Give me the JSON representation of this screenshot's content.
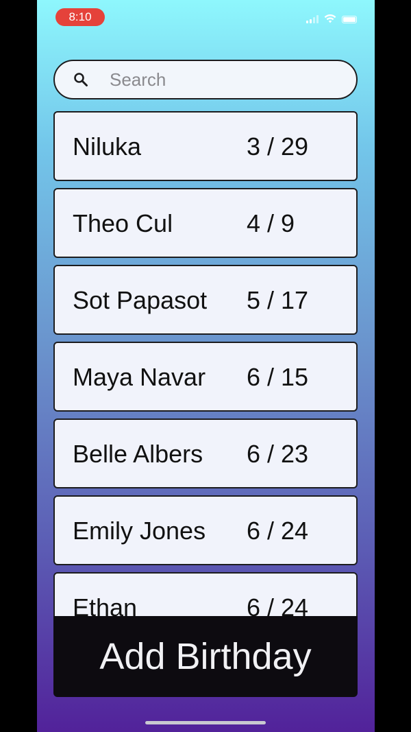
{
  "status_bar": {
    "time": "8:10",
    "time_badge_color": "#e5423a",
    "icons": [
      "signal-icon",
      "wifi-icon",
      "battery-icon"
    ]
  },
  "search": {
    "placeholder": "Search",
    "value": "",
    "icon": "search-icon"
  },
  "birthdays": [
    {
      "name": "Niluka",
      "date": "3 / 29"
    },
    {
      "name": "Theo Cul",
      "date": "4 / 9"
    },
    {
      "name": "Sot Papasot",
      "date": "5 / 17"
    },
    {
      "name": "Maya Navar",
      "date": "6 / 15"
    },
    {
      "name": "Belle Albers",
      "date": "6 / 23"
    },
    {
      "name": "Emily Jones",
      "date": "6 / 24"
    },
    {
      "name": "Ethan",
      "date": "6 / 24"
    }
  ],
  "add_button": {
    "label": "Add Birthday"
  },
  "colors": {
    "gradient_top": "#8ef7fd",
    "gradient_bottom": "#52229a",
    "row_background": "#f1f3fb",
    "button_background": "#0d0b10"
  }
}
